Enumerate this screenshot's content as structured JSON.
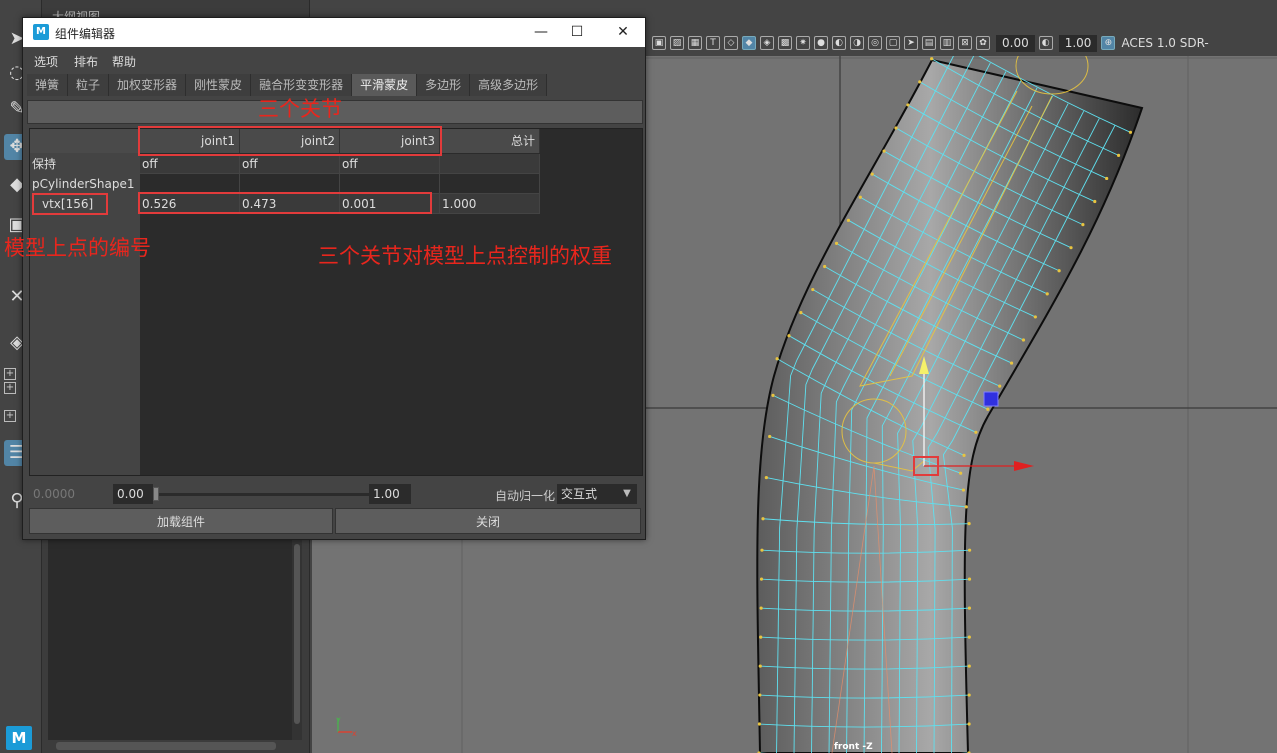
{
  "app": {
    "outliner_tab": "大纲视图",
    "toolbar": {
      "field1": "0.00",
      "field2": "1.00",
      "aces_label": "ACES 1.0 SDR-"
    },
    "viewport": {
      "camera_label": "front -Z"
    }
  },
  "window": {
    "title": "组件编辑器",
    "controls": {
      "minimize": "—",
      "maximize": "☐",
      "close": "✕"
    },
    "menu": [
      "选项",
      "排布",
      "帮助"
    ],
    "tabs": [
      "弹簧",
      "粒子",
      "加权变形器",
      "刚性蒙皮",
      "融合形变变形器",
      "平滑蒙皮",
      "多边形",
      "高级多边形"
    ],
    "active_tab": "平滑蒙皮",
    "columns": [
      "joint1",
      "joint2",
      "joint3",
      "总计"
    ],
    "rows": [
      {
        "label": "保持",
        "values": [
          "off",
          "off",
          "off",
          ""
        ]
      },
      {
        "label": "pCylinderShape1",
        "values": [
          "",
          "",
          "",
          ""
        ]
      },
      {
        "label": "vtx[156]",
        "values": [
          "0.526",
          "0.473",
          "0.001",
          "1.000"
        ]
      }
    ],
    "bottom": {
      "value_left": "0.0000",
      "value_min": "0.00",
      "slider_value": 0,
      "value_max": "1.00",
      "auto_normalize_label": "自动归一化",
      "mode": "交互式"
    },
    "buttons": {
      "load": "加载组件",
      "close": "关闭"
    }
  },
  "annotations": {
    "joints": "三个关节",
    "vertex_id": "模型上点的编号",
    "weights": "三个关节对模型上点控制的权重"
  },
  "colors": {
    "annotation_red": "#e8261d",
    "accent_blue": "#5285a6",
    "wire_cyan": "#5fe0ef",
    "joint_yellow": "#e8c440"
  }
}
